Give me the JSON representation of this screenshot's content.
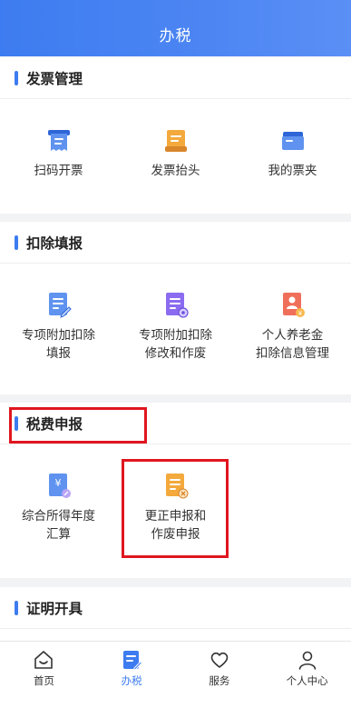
{
  "header": {
    "title": "办税"
  },
  "sections": {
    "invoice": {
      "title": "发票管理",
      "items": [
        {
          "label1": "扫码开票",
          "icon": "scan-invoice-icon"
        },
        {
          "label1": "发票抬头",
          "icon": "invoice-header-icon"
        },
        {
          "label1": "我的票夹",
          "icon": "ticket-folder-icon"
        }
      ]
    },
    "deduction": {
      "title": "扣除填报",
      "items": [
        {
          "label1": "专项附加扣除",
          "label2": "填报",
          "icon": "edit-doc-icon"
        },
        {
          "label1": "专项附加扣除",
          "label2": "修改和作废",
          "icon": "settings-doc-icon"
        },
        {
          "label1": "个人养老金",
          "label2": "扣除信息管理",
          "icon": "pension-icon"
        }
      ]
    },
    "tax": {
      "title": "税费申报",
      "items": [
        {
          "label1": "综合所得年度",
          "label2": "汇算",
          "icon": "yuan-doc-icon"
        },
        {
          "label1": "更正申报和",
          "label2": "作废申报",
          "icon": "correct-doc-icon"
        }
      ]
    },
    "certificate": {
      "title": "证明开具"
    }
  },
  "tabbar": [
    {
      "label": "首页",
      "icon": "home-icon"
    },
    {
      "label": "办税",
      "icon": "tax-icon"
    },
    {
      "label": "服务",
      "icon": "service-icon"
    },
    {
      "label": "个人中心",
      "icon": "profile-icon"
    }
  ],
  "colors": {
    "accent": "#3d7cf0",
    "highlight": "#e0161f"
  }
}
